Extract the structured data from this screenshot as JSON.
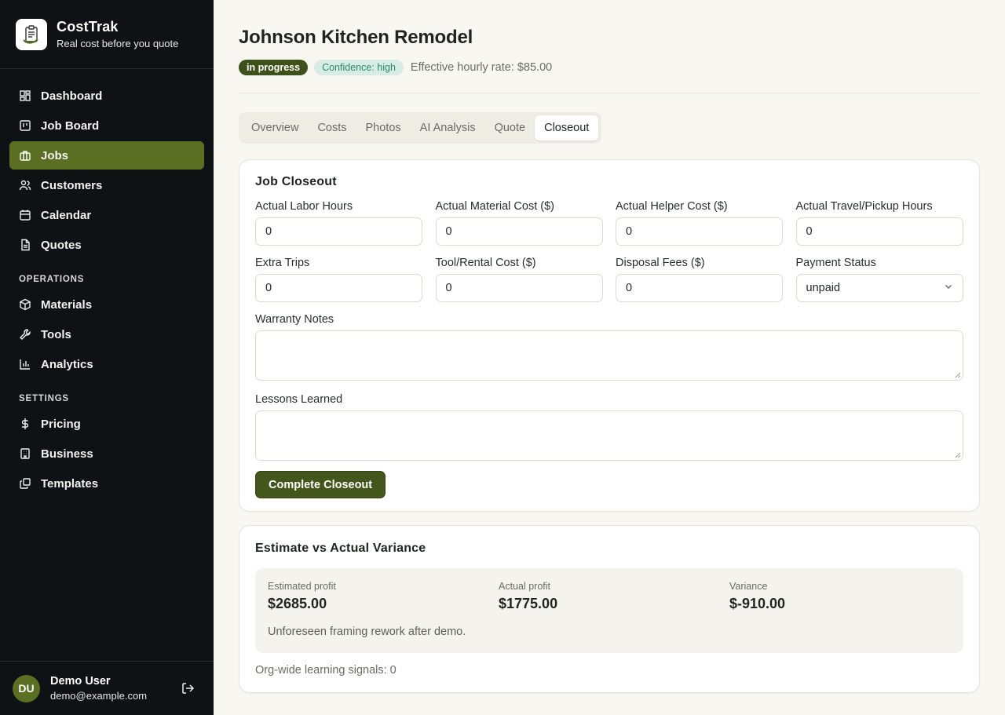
{
  "brand": {
    "name": "CostTrak",
    "tagline": "Real cost before you quote"
  },
  "nav": {
    "main": [
      {
        "label": "Dashboard",
        "icon": "dashboard-icon"
      },
      {
        "label": "Job Board",
        "icon": "kanban-icon"
      },
      {
        "label": "Jobs",
        "icon": "briefcase-icon",
        "active": true
      },
      {
        "label": "Customers",
        "icon": "users-icon"
      },
      {
        "label": "Calendar",
        "icon": "calendar-icon"
      },
      {
        "label": "Quotes",
        "icon": "document-icon"
      }
    ],
    "operations_label": "OPERATIONS",
    "operations": [
      {
        "label": "Materials",
        "icon": "box-icon"
      },
      {
        "label": "Tools",
        "icon": "wrench-icon"
      },
      {
        "label": "Analytics",
        "icon": "bar-chart-icon"
      }
    ],
    "settings_label": "SETTINGS",
    "settings": [
      {
        "label": "Pricing",
        "icon": "dollar-icon"
      },
      {
        "label": "Business",
        "icon": "building-icon"
      },
      {
        "label": "Templates",
        "icon": "templates-icon"
      }
    ]
  },
  "user": {
    "initials": "DU",
    "name": "Demo User",
    "email": "demo@example.com"
  },
  "job": {
    "title": "Johnson Kitchen Remodel",
    "status": "in progress",
    "confidence": "Confidence: high",
    "rate": "Effective hourly rate: $85.00"
  },
  "tabs": [
    "Overview",
    "Costs",
    "Photos",
    "AI Analysis",
    "Quote",
    "Closeout"
  ],
  "active_tab": "Closeout",
  "closeout": {
    "title": "Job Closeout",
    "fields": [
      {
        "label": "Actual Labor Hours",
        "value": "0"
      },
      {
        "label": "Actual Material Cost ($)",
        "value": "0"
      },
      {
        "label": "Actual Helper Cost ($)",
        "value": "0"
      },
      {
        "label": "Actual Travel/Pickup Hours",
        "value": "0"
      },
      {
        "label": "Extra Trips",
        "value": "0"
      },
      {
        "label": "Tool/Rental Cost ($)",
        "value": "0"
      },
      {
        "label": "Disposal Fees ($)",
        "value": "0"
      }
    ],
    "payment_status": {
      "label": "Payment Status",
      "value": "unpaid"
    },
    "warranty_label": "Warranty Notes",
    "warranty_value": "",
    "lessons_label": "Lessons Learned",
    "lessons_value": "",
    "submit_label": "Complete Closeout"
  },
  "variance": {
    "title": "Estimate vs Actual Variance",
    "estimated_label": "Estimated profit",
    "estimated_value": "$2685.00",
    "actual_label": "Actual profit",
    "actual_value": "$1775.00",
    "variance_label": "Variance",
    "variance_value": "$-910.00",
    "note": "Unforeseen framing rework after demo.",
    "signals": "Org-wide learning signals: 0"
  }
}
